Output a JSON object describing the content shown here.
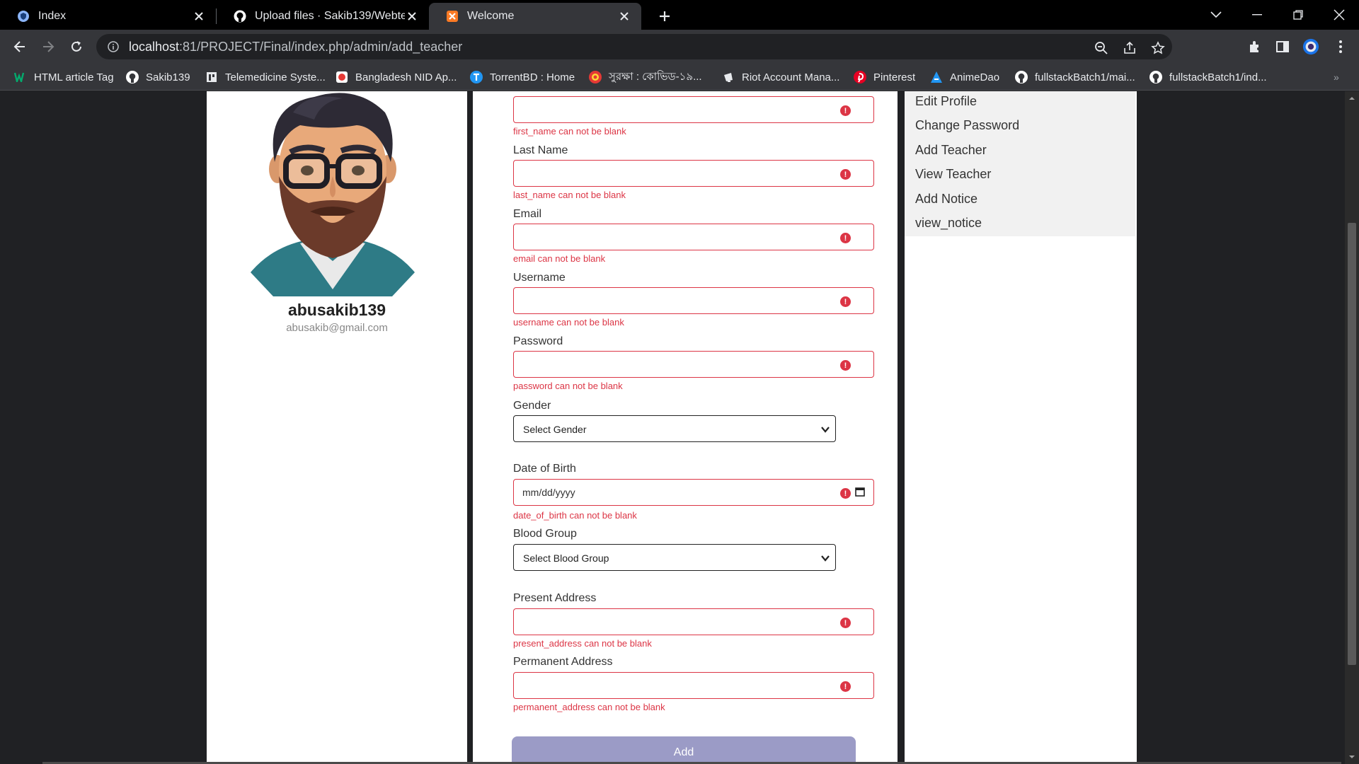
{
  "browser": {
    "tabs": [
      {
        "title": "Index",
        "icon": "shield-icon",
        "active": false
      },
      {
        "title": "Upload files · Sakib139/Webtech_",
        "icon": "github-icon",
        "active": false
      },
      {
        "title": "Welcome",
        "icon": "xampp-icon",
        "active": true
      }
    ],
    "url_host": "localhost",
    "url_rest": ":81/PROJECT/Final/index.php/admin/add_teacher",
    "bookmarks": [
      {
        "label": "HTML article Tag",
        "icon": "w3-icon",
        "color": "#04aa6d"
      },
      {
        "label": "Sakib139",
        "icon": "github-icon",
        "color": "#ffffff"
      },
      {
        "label": "Telemedicine Syste...",
        "icon": "doc-icon",
        "color": "#ffffff"
      },
      {
        "label": "Bangladesh NID Ap...",
        "icon": "nid-icon",
        "color": "#e53935"
      },
      {
        "label": "TorrentBD : Home",
        "icon": "torrent-icon",
        "color": "#2196f3"
      },
      {
        "label": "সুরক্ষা : কোভিড-১৯...",
        "icon": "gov-icon",
        "color": "#e53935"
      },
      {
        "label": "Riot Account Mana...",
        "icon": "riot-icon",
        "color": "#e8eaed"
      },
      {
        "label": "Pinterest",
        "icon": "pinterest-icon",
        "color": "#e60023"
      },
      {
        "label": "AnimeDao",
        "icon": "anime-icon",
        "color": "#2196f3"
      },
      {
        "label": "fullstackBatch1/mai...",
        "icon": "github-icon",
        "color": "#ffffff"
      },
      {
        "label": "fullstackBatch1/ind...",
        "icon": "github-icon",
        "color": "#ffffff"
      }
    ]
  },
  "profile": {
    "name": "abusakib139",
    "email": "abusakib@gmail.com"
  },
  "form": {
    "first_name_error": "first_name can not be blank",
    "last_name_label": "Last Name",
    "last_name_error": "last_name can not be blank",
    "email_label": "Email",
    "email_error": "email can not be blank",
    "username_label": "Username",
    "username_error": "username can not be blank",
    "password_label": "Password",
    "password_error": "password can not be blank",
    "gender_label": "Gender",
    "gender_value": "Select Gender",
    "dob_label": "Date of Birth",
    "dob_placeholder": "mm/dd/yyyy",
    "dob_error": "date_of_birth can not be blank",
    "blood_label": "Blood Group",
    "blood_value": "Select Blood Group",
    "present_label": "Present Address",
    "present_error": "present_address can not be blank",
    "permanent_label": "Permanent Address",
    "permanent_error": "permanent_address can not be blank",
    "submit_label": "Add",
    "error_color": "#dc3545"
  },
  "menu": {
    "items": [
      "Edit Profile",
      "Change Password",
      "Add Teacher",
      "View Teacher",
      "Add Notice",
      "view_notice"
    ]
  }
}
